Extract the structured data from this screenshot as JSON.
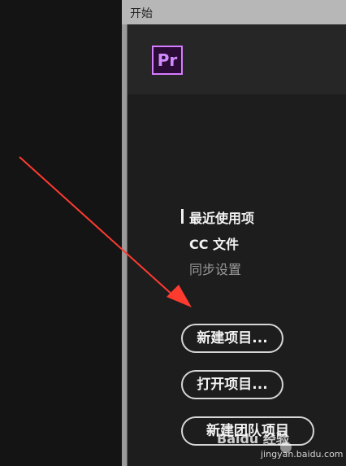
{
  "window": {
    "title": "开始"
  },
  "logo": {
    "label": "Pr"
  },
  "menu": {
    "items": [
      {
        "label": "最近使用项"
      },
      {
        "label": "CC 文件"
      },
      {
        "label": "同步设置"
      }
    ]
  },
  "buttons": {
    "new_project": "新建项目...",
    "open_project": "打开项目...",
    "new_team_project": "新建团队项目"
  },
  "watermark": {
    "main": "Baidu 经验",
    "sub": "jingyan.baidu.com"
  },
  "colors": {
    "logo_purple": "#d67cff",
    "annotation_red": "#ff3b30"
  },
  "icons": {
    "premiere": "pr-logo",
    "annotation": "red-arrow"
  }
}
